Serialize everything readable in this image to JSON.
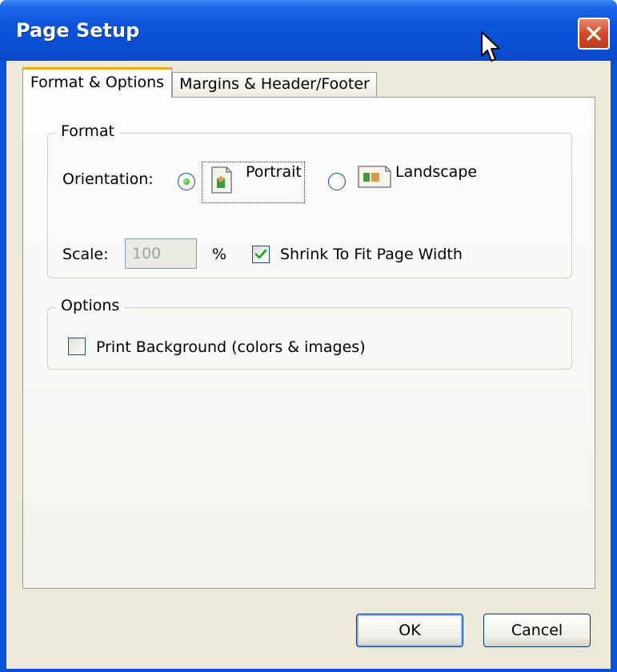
{
  "window": {
    "title": "Page Setup"
  },
  "tabs": [
    {
      "label": "Format & Options",
      "active": true
    },
    {
      "label": "Margins & Header/Footer",
      "active": false
    }
  ],
  "format_group": {
    "legend": "Format",
    "orientation_label": "Orientation:",
    "portrait_label": "Portrait",
    "landscape_label": "Landscape",
    "selected_orientation": "Portrait",
    "scale_label": "Scale:",
    "scale_value": "100",
    "scale_unit": "%",
    "shrink_label": "Shrink To Fit Page Width",
    "shrink_checked": true
  },
  "options_group": {
    "legend": "Options",
    "print_background_label": "Print Background (colors & images)",
    "print_background_checked": false
  },
  "buttons": {
    "ok_label": "OK",
    "cancel_label": "Cancel"
  },
  "colors": {
    "titlebar": "#0a54db",
    "dialog_face": "#ece9d8",
    "active_tab_accent": "#f5a623",
    "close_button": "#d44a2c",
    "radio_dot": "#21a121",
    "checkmark": "#21a121"
  },
  "icons": [
    "close-icon",
    "portrait-page-icon",
    "landscape-page-icon",
    "checkmark-icon",
    "mouse-cursor-icon"
  ]
}
